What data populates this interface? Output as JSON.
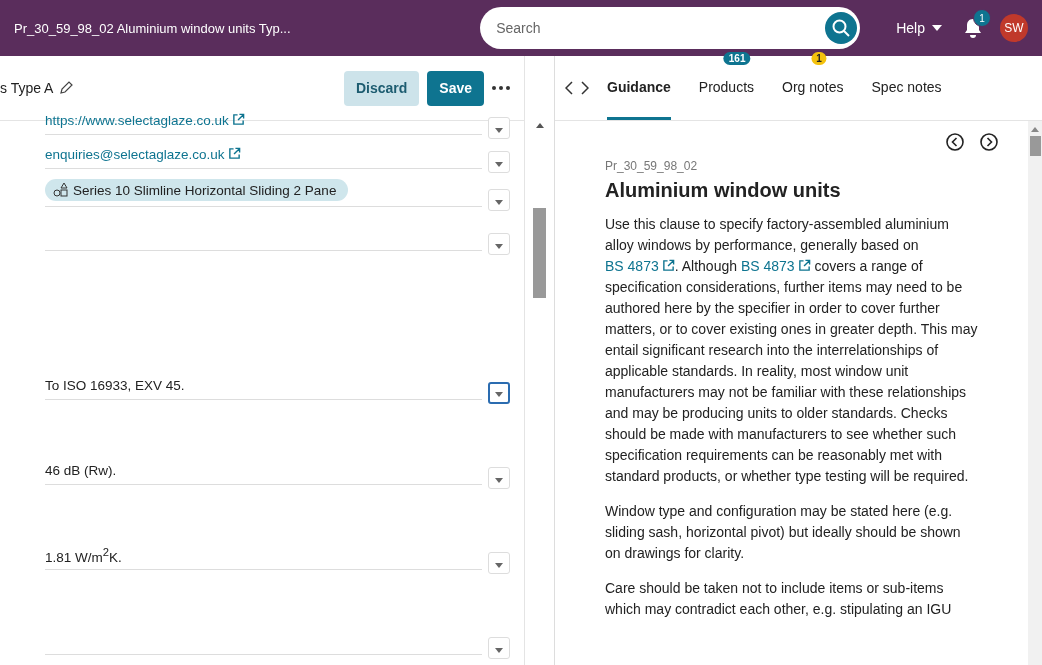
{
  "header": {
    "title": "Pr_30_59_98_02 Aluminium window units Typ...",
    "search": {
      "placeholder": "Search"
    },
    "help": "Help",
    "notifications": "1",
    "avatar": "SW"
  },
  "toolbar": {
    "name": "s Type A",
    "buttons": [
      {
        "label": "Discard",
        "kind": "secondary"
      },
      {
        "label": "Save",
        "kind": "primary"
      }
    ]
  },
  "fields": [
    {
      "kind": "link",
      "value": "https://www.selectaglaze.co.uk",
      "focused": false
    },
    {
      "kind": "link",
      "value": "enquiries@selectaglaze.co.uk",
      "focused": false
    },
    {
      "kind": "chip",
      "value": "Series 10 Slimline Horizontal Sliding 2 Pane",
      "focused": false
    },
    {
      "kind": "empty",
      "focused": false
    }
  ],
  "properties": [
    {
      "value": "To ISO 16933, EXV 45.",
      "focused": true
    },
    {
      "value": "46 dB (Rw).",
      "focused": false
    },
    {
      "value": "1.81 W/m$^{2}$K.",
      "focused": false
    },
    {
      "focused": false
    }
  ],
  "tabs": [
    {
      "label": "Guidance",
      "selected": true
    },
    {
      "label": "Products",
      "selected": false,
      "badge": "161",
      "color": "#0e7490"
    },
    {
      "label": "Org notes",
      "selected": false,
      "badge": "1",
      "color": "#f4c20d"
    },
    {
      "label": "Spec notes",
      "selected": false
    }
  ],
  "guidance": {
    "code": "Pr_30_59_98_02",
    "title": "Aluminium window units",
    "paragraphs": [
      [
        {
          "kind": "text",
          "text": "Use this clause to specify factory-assembled aluminium alloy windows by performance, generally based on "
        },
        {
          "kind": "link",
          "text": "BS 4873"
        },
        {
          "kind": "text",
          "text": ". Although "
        },
        {
          "kind": "link",
          "text": "BS 4873"
        },
        {
          "kind": "text",
          "text": " covers a range of specification considerations, further items may need to be authored here by the specifier in order to cover further matters, or to cover existing ones in greater depth. This may entail significant research into the interrelationships of applicable standards. In reality, most window unit manufacturers may not be familiar with these relationships and may be producing units to older standards. Checks should be made with manufacturers to see whether such specification requirements can be reasonably met with standard products, or whether type testing will be required."
        }
      ],
      [
        {
          "kind": "text",
          "text": "Window type and configuration may be stated here (e.g. sliding sash, horizontal pivot) but ideally should be shown on drawings for clarity."
        }
      ],
      [
        {
          "kind": "text",
          "text": "Care should be taken not to include items or sub-items which may contradict each other, e.g. stipulating an IGU"
        }
      ]
    ]
  }
}
